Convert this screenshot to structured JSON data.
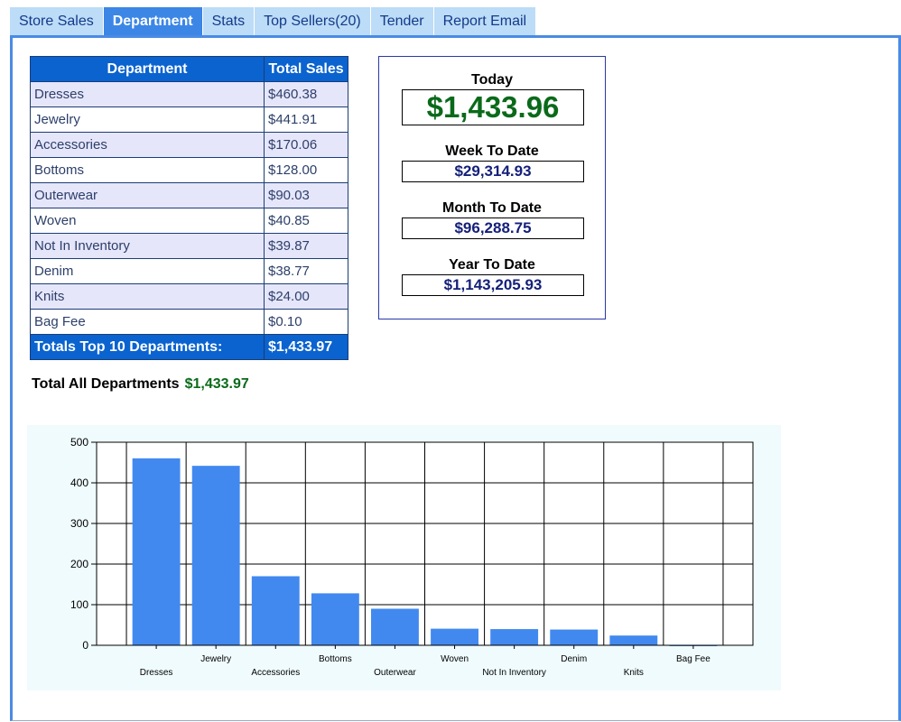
{
  "tabs": [
    {
      "label": "Store Sales",
      "active": false
    },
    {
      "label": "Department",
      "active": true
    },
    {
      "label": "Stats",
      "active": false
    },
    {
      "label": "Top Sellers(20)",
      "active": false
    },
    {
      "label": "Tender",
      "active": false
    },
    {
      "label": "Report Email",
      "active": false
    }
  ],
  "table": {
    "headers": [
      "Department",
      "Total Sales"
    ],
    "rows": [
      {
        "dept": "Dresses",
        "sales": "$460.38"
      },
      {
        "dept": "Jewelry",
        "sales": "$441.91"
      },
      {
        "dept": "Accessories",
        "sales": "$170.06"
      },
      {
        "dept": "Bottoms",
        "sales": "$128.00"
      },
      {
        "dept": "Outerwear",
        "sales": "$90.03"
      },
      {
        "dept": "Woven",
        "sales": "$40.85"
      },
      {
        "dept": "Not In Inventory",
        "sales": "$39.87"
      },
      {
        "dept": "Denim",
        "sales": "$38.77"
      },
      {
        "dept": "Knits",
        "sales": "$24.00"
      },
      {
        "dept": "Bag Fee",
        "sales": "$0.10"
      }
    ],
    "total_label": "Totals Top 10 Departments:",
    "total_value": "$1,433.97"
  },
  "summary": {
    "today_label": "Today",
    "today_value": "$1,433.96",
    "week_label": "Week To Date",
    "week_value": "$29,314.93",
    "month_label": "Month To Date",
    "month_value": "$96,288.75",
    "year_label": "Year To Date",
    "year_value": "$1,143,205.93"
  },
  "total_all": {
    "label": "Total All Departments",
    "value": "$1,433.97"
  },
  "colors": {
    "accent": "#0a63cf",
    "tab_bg": "#bcdcf7",
    "bar": "#4189ef",
    "green_value": "#0a6a1a",
    "navy_value": "#14207a"
  },
  "chart_data": {
    "type": "bar",
    "categories": [
      "Dresses",
      "Jewelry",
      "Accessories",
      "Bottoms",
      "Outerwear",
      "Woven",
      "Not In Inventory",
      "Denim",
      "Knits",
      "Bag Fee"
    ],
    "values": [
      460.38,
      441.91,
      170.06,
      128.0,
      90.03,
      40.85,
      39.87,
      38.77,
      24.0,
      0.1
    ],
    "ylim": [
      0,
      500
    ],
    "yticks": [
      "0",
      "100",
      "200",
      "300",
      "400",
      "500"
    ],
    "grid": true
  }
}
